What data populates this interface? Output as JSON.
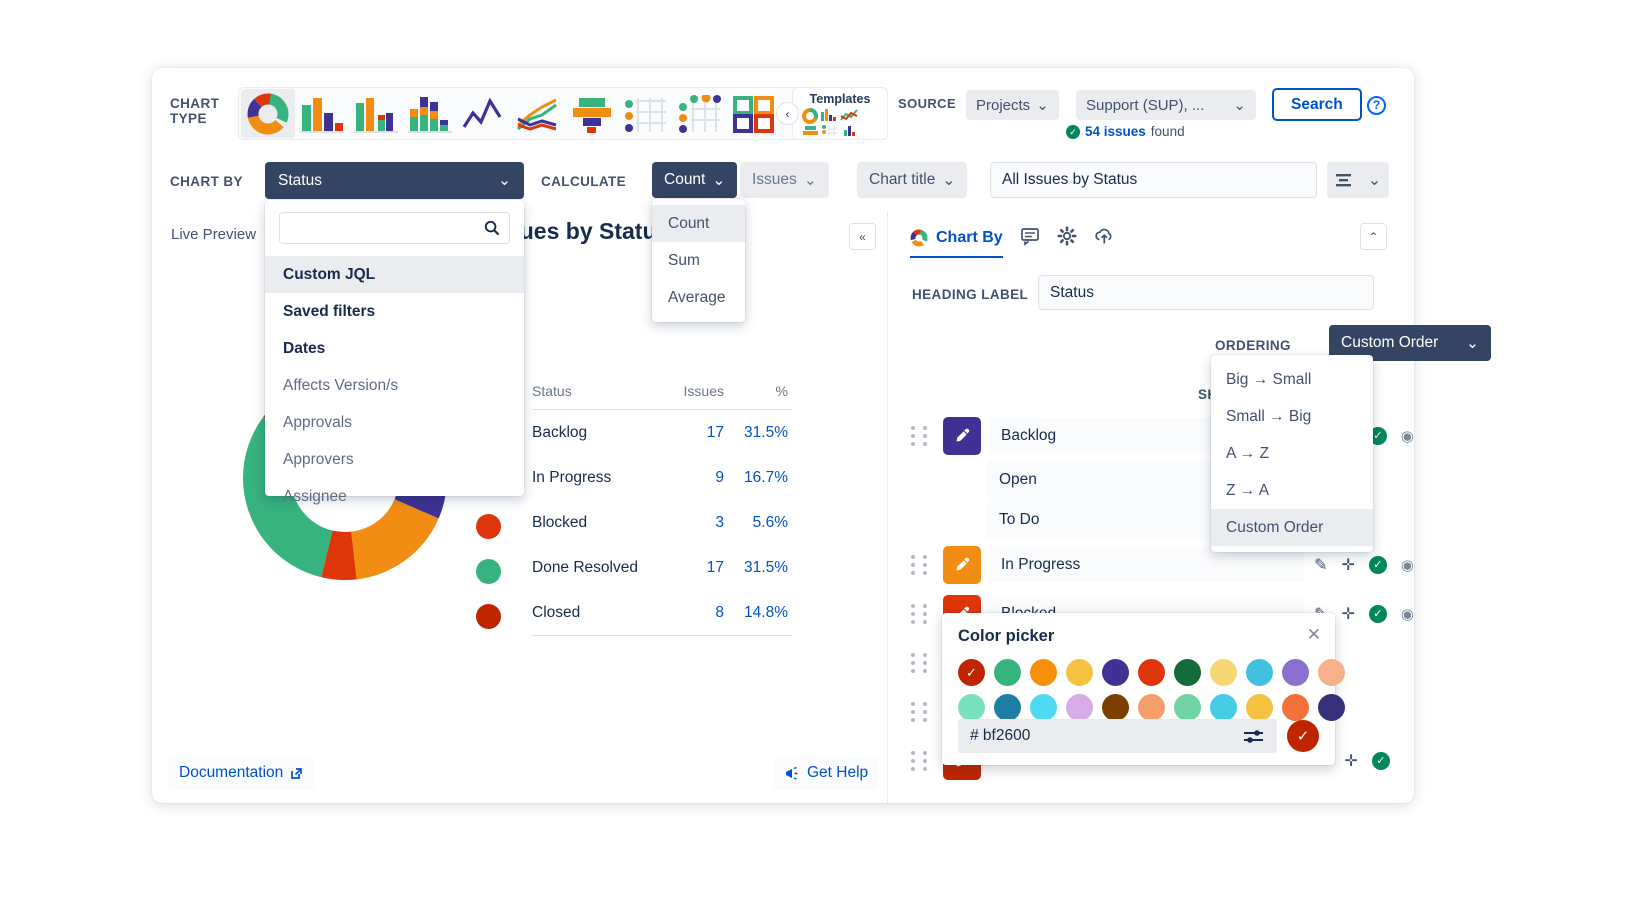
{
  "toolbar": {
    "chart_type_label": "CHART\nTYPE",
    "chart_type_line1": "CHART",
    "chart_type_line2": "TYPE",
    "templates_label": "Templates",
    "source_label": "SOURCE",
    "source_projects": "Projects",
    "source_value": "Support (SUP), ...",
    "search_label": "Search",
    "help_glyph": "?",
    "issues_count": "54 issues",
    "issues_found_suffix": " found",
    "chart_type_icons": [
      "donut-chart-icon",
      "bar-chart-icon",
      "column-chart-icon",
      "stacked-bar-icon",
      "line-chart-icon",
      "multi-line-icon",
      "funnel-chart-icon",
      "dot-matrix-icon",
      "bubble-matrix-icon",
      "tiles-chart-icon"
    ]
  },
  "row2": {
    "chart_by_label": "CHART BY",
    "chart_by_value": "Status",
    "calculate_label": "CALCULATE",
    "calculate_value": "Count",
    "calculate_target": "Issues",
    "chart_title_label": "Chart title",
    "chart_title_value": "All Issues by Status",
    "chart_title_placeholder": "Chart title"
  },
  "chart_by_dropdown": {
    "search_value": "",
    "search_placeholder": "",
    "options": [
      {
        "label": "Custom JQL",
        "bold": true,
        "highlighted": true
      },
      {
        "label": "Saved filters",
        "bold": true,
        "highlighted": false
      },
      {
        "label": "Dates",
        "bold": true,
        "highlighted": false
      },
      {
        "label": "Affects Version/s",
        "bold": false,
        "highlighted": false
      },
      {
        "label": "Approvals",
        "bold": false,
        "highlighted": false
      },
      {
        "label": "Approvers",
        "bold": false,
        "highlighted": false
      },
      {
        "label": "Assignee",
        "bold": false,
        "highlighted": false
      }
    ]
  },
  "calculate_dropdown": {
    "options": [
      {
        "label": "Count",
        "highlighted": true
      },
      {
        "label": "Sum",
        "highlighted": false
      },
      {
        "label": "Average",
        "highlighted": false
      }
    ]
  },
  "preview": {
    "live_preview_label": "Live Preview",
    "chart_title": "All Issues by Status",
    "documentation_label": "Documentation",
    "get_help_label": "Get Help"
  },
  "chart_data": {
    "type": "pie",
    "title": "All Issues by Status",
    "columns": [
      "Status",
      "Issues",
      "%"
    ],
    "total_issues": 54,
    "categories": [
      "Backlog",
      "In Progress",
      "Blocked",
      "Done Resolved",
      "Closed"
    ],
    "values": [
      17,
      9,
      3,
      17,
      8
    ],
    "percents": [
      "31.5%",
      "16.7%",
      "5.6%",
      "31.5%",
      "14.8%"
    ],
    "colors": [
      "#403294",
      "#F18D13",
      "#DE350B",
      "#36B37E",
      "#BF2600"
    ],
    "legend": "right",
    "donut": true
  },
  "right_panel": {
    "tab_active": "Chart By",
    "tab_icons": [
      "comment-icon",
      "gear-icon",
      "cloud-upload-icon"
    ],
    "heading_label": "HEADING LABEL",
    "heading_value": "Status",
    "ordering_label": "ORDERING",
    "ordering_value": "Custom Order",
    "show_zero_label": "SHOW ZE",
    "rows": [
      {
        "label": "Backlog",
        "color": "#403294",
        "children": [
          "Open",
          "To Do"
        ]
      },
      {
        "label": "In Progress",
        "color": "#F18D13",
        "children": []
      },
      {
        "label": "Blocked",
        "color": "#DE350B",
        "children": []
      },
      {
        "label": "",
        "color": "",
        "children": []
      },
      {
        "label": "",
        "color": "",
        "children": []
      }
    ]
  },
  "ordering_dropdown": {
    "options": [
      {
        "label": "Big → Small",
        "highlighted": false
      },
      {
        "label": "Small → Big",
        "highlighted": false
      },
      {
        "label": "A → Z",
        "highlighted": false
      },
      {
        "label": "Z → A",
        "highlighted": false
      },
      {
        "label": "Custom Order",
        "highlighted": true
      }
    ]
  },
  "color_picker": {
    "title": "Color picker",
    "hex_value": "# bf2600",
    "selected_color": "#BF2600",
    "swatches_row1": [
      "#BF2600",
      "#36B37E",
      "#F79009",
      "#F5C141",
      "#403294",
      "#DE350B",
      "#146B3A",
      "#F7D774",
      "#41C0E0",
      "#8B6FD1",
      "#F6B18A"
    ],
    "swatches_row2": [
      "#7AE1BF",
      "#1D7FA3",
      "#4FD8F2",
      "#D6ABE8",
      "#7B3F00",
      "#F49F6B",
      "#6FD3A3",
      "#45CCE5",
      "#F5C141",
      "#F4703A",
      "#36307B"
    ]
  }
}
